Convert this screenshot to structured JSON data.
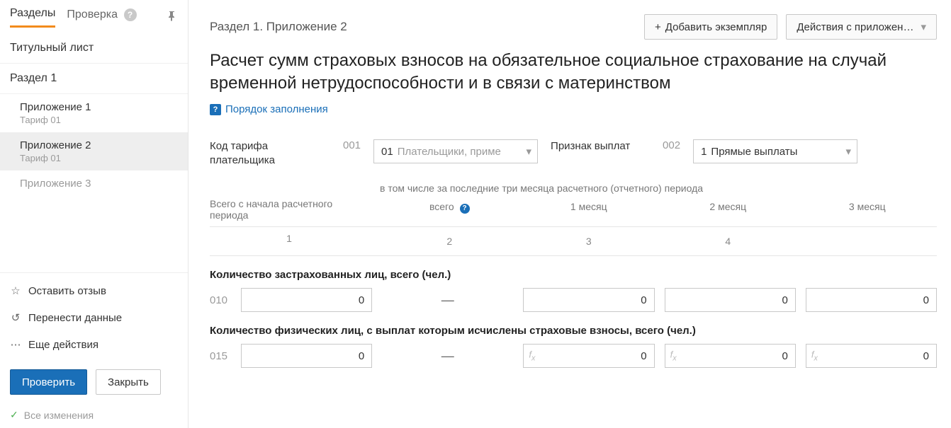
{
  "sidebar": {
    "tabs": {
      "sections": "Разделы",
      "check": "Проверка"
    },
    "nav": {
      "title_page": "Титульный лист",
      "section1": "Раздел 1",
      "app1": "Приложение 1",
      "app1_tariff": "Тариф 01",
      "app2": "Приложение 2",
      "app2_tariff": "Тариф 01",
      "app3": "Приложение 3"
    },
    "actions": {
      "feedback": "Оставить отзыв",
      "transfer": "Перенести данные",
      "more": "Еще действия"
    },
    "buttons": {
      "check": "Проверить",
      "close": "Закрыть"
    },
    "status": "Все изменения"
  },
  "main": {
    "breadcrumb": "Раздел 1. Приложение 2",
    "add_button": "Добавить экземпляр",
    "actions_button": "Действия с приложен…",
    "title": "Расчет сумм страховых взносов на обязательное социальное страхование на случай временной нетрудоспособности и в связи с материнством",
    "help_link": "Порядок заполнения",
    "params": {
      "tariff_label": "Код тарифа плательщика",
      "tariff_code": "001",
      "tariff_value_pre": "01",
      "tariff_value_txt": "Плательщики, приме",
      "pay_label": "Признак выплат",
      "pay_code": "002",
      "pay_value_pre": "1",
      "pay_value_txt": "Прямые выплаты"
    },
    "table": {
      "h_begin": "Всего с начала расчетного периода",
      "h_group": "в том числе за последние три месяца расчетного (отчетного) периода",
      "h_total": "всего",
      "h_m1": "1 месяц",
      "h_m2": "2 месяц",
      "h_m3": "3 месяц",
      "n1": "1",
      "n2": "2",
      "n3": "3",
      "n4": "4",
      "row010_title": "Количество застрахованных лиц, всего (чел.)",
      "row010_num": "010",
      "row010": {
        "begin": "0",
        "m1": "0",
        "m2": "0",
        "m3": "0"
      },
      "row015_title": "Количество физических лиц, с выплат которым исчислены страховые взносы, всего (чел.)",
      "row015_num": "015",
      "row015": {
        "begin": "0",
        "m1": "0",
        "m2": "0",
        "m3": "0"
      }
    }
  }
}
